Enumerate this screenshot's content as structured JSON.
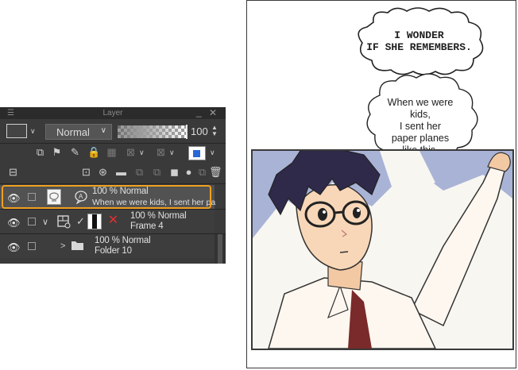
{
  "layer_panel": {
    "title": "Layer",
    "blend_mode": "Normal",
    "opacity": "100",
    "opacity_fraction": 1.0,
    "selected_color": "#2a68d8",
    "layers": [
      {
        "line1": "100 % Normal",
        "line2": "When we were kids, I sent her pa",
        "selected": true
      },
      {
        "line1": "100 % Normal",
        "line2": "Frame 4",
        "selected": false
      },
      {
        "line1": "100 % Normal",
        "line2": "Folder 10",
        "selected": false
      }
    ]
  },
  "comic": {
    "shout_bubble": "I WONDER\nIF SHE REMEMBERS.",
    "thought_bubble": "When we were kids,\nI sent her\npaper planes\nlike this."
  },
  "colors": {
    "highlight": "#f0a020",
    "panel_bg": "#3a3a3a",
    "sky": "#a9b3d6"
  }
}
